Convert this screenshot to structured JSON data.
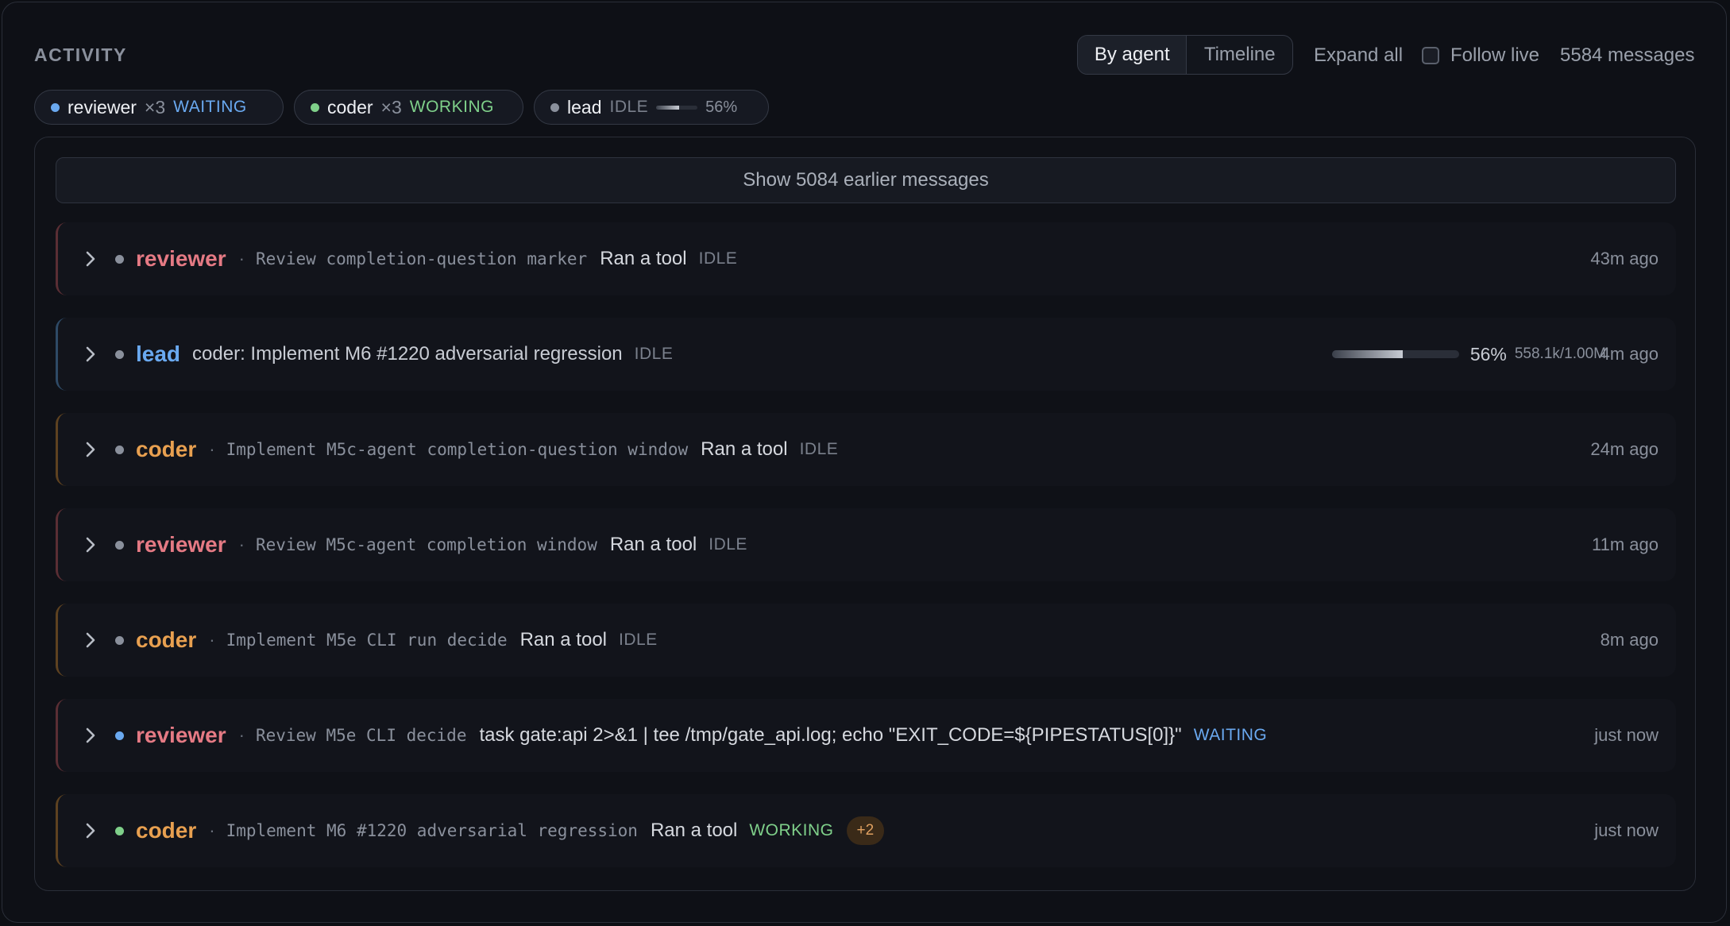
{
  "header": {
    "title": "ACTIVITY",
    "view_modes": [
      "By agent",
      "Timeline"
    ],
    "active_view": "By agent",
    "expand_all": "Expand all",
    "follow_live": {
      "label": "Follow live",
      "checked": false
    },
    "message_count": "5584 messages"
  },
  "chips": [
    {
      "name": "reviewer",
      "count": "×3",
      "status": "WAITING",
      "dot_color": "#6aa9f0",
      "status_color": "#6aa9f0"
    },
    {
      "name": "coder",
      "count": "×3",
      "status": "WORKING",
      "dot_color": "#7fd08a",
      "status_color": "#7fd08a"
    },
    {
      "name": "lead",
      "status": "IDLE",
      "dot_color": "#8a909c",
      "status_color": "#7a808c",
      "context_fraction": 0.56,
      "context_pct": "56%"
    }
  ],
  "show_earlier": "Show 5084 earlier messages",
  "rows": [
    {
      "agent": "reviewer",
      "agent_color": "#e57a84",
      "border_color": "#5a2e34",
      "dot_color": "#8a909c",
      "sep": "·",
      "task": "Review completion-question marker",
      "action": "Ran a tool",
      "status": "IDLE",
      "status_color": "#7a808c",
      "time": "43m ago"
    },
    {
      "agent": "lead",
      "agent_color": "#6aa9f0",
      "border_color": "#2e4a66",
      "dot_color": "#8a909c",
      "task_plain": "coder: Implement M6 #1220 adversarial regression",
      "status": "IDLE",
      "status_color": "#7a808c",
      "context_fraction": 0.56,
      "context_pct": "56%",
      "context_tokens": "558.1k/1.00M",
      "time": "4m ago"
    },
    {
      "agent": "coder",
      "agent_color": "#e8a050",
      "border_color": "#5e4220",
      "dot_color": "#8a909c",
      "sep": "·",
      "task": "Implement M5c-agent completion-question window",
      "action": "Ran a tool",
      "status": "IDLE",
      "status_color": "#7a808c",
      "time": "24m ago"
    },
    {
      "agent": "reviewer",
      "agent_color": "#e57a84",
      "border_color": "#5a2e34",
      "dot_color": "#8a909c",
      "sep": "·",
      "task": "Review M5c-agent completion window",
      "action": "Ran a tool",
      "status": "IDLE",
      "status_color": "#7a808c",
      "time": "11m ago"
    },
    {
      "agent": "coder",
      "agent_color": "#e8a050",
      "border_color": "#5e4220",
      "dot_color": "#8a909c",
      "sep": "·",
      "task": "Implement M5e CLI run decide",
      "action": "Ran a tool",
      "status": "IDLE",
      "status_color": "#7a808c",
      "time": "8m ago"
    },
    {
      "agent": "reviewer",
      "agent_color": "#e57a84",
      "border_color": "#5a2e34",
      "dot_color": "#6aa9f0",
      "sep": "·",
      "task": "Review M5e CLI decide",
      "action": "task gate:api 2>&1 | tee /tmp/gate_api.log; echo \"EXIT_CODE=${PIPESTATUS[0]}\"",
      "status": "WAITING",
      "status_color": "#6aa9f0",
      "time": "just now"
    },
    {
      "agent": "coder",
      "agent_color": "#e8a050",
      "border_color": "#5e4220",
      "dot_color": "#7fd08a",
      "sep": "·",
      "task": "Implement M6 #1220 adversarial regression",
      "action": "Ran a tool",
      "status": "WORKING",
      "status_color": "#7fd08a",
      "extra": "+2",
      "time": "just now"
    }
  ]
}
